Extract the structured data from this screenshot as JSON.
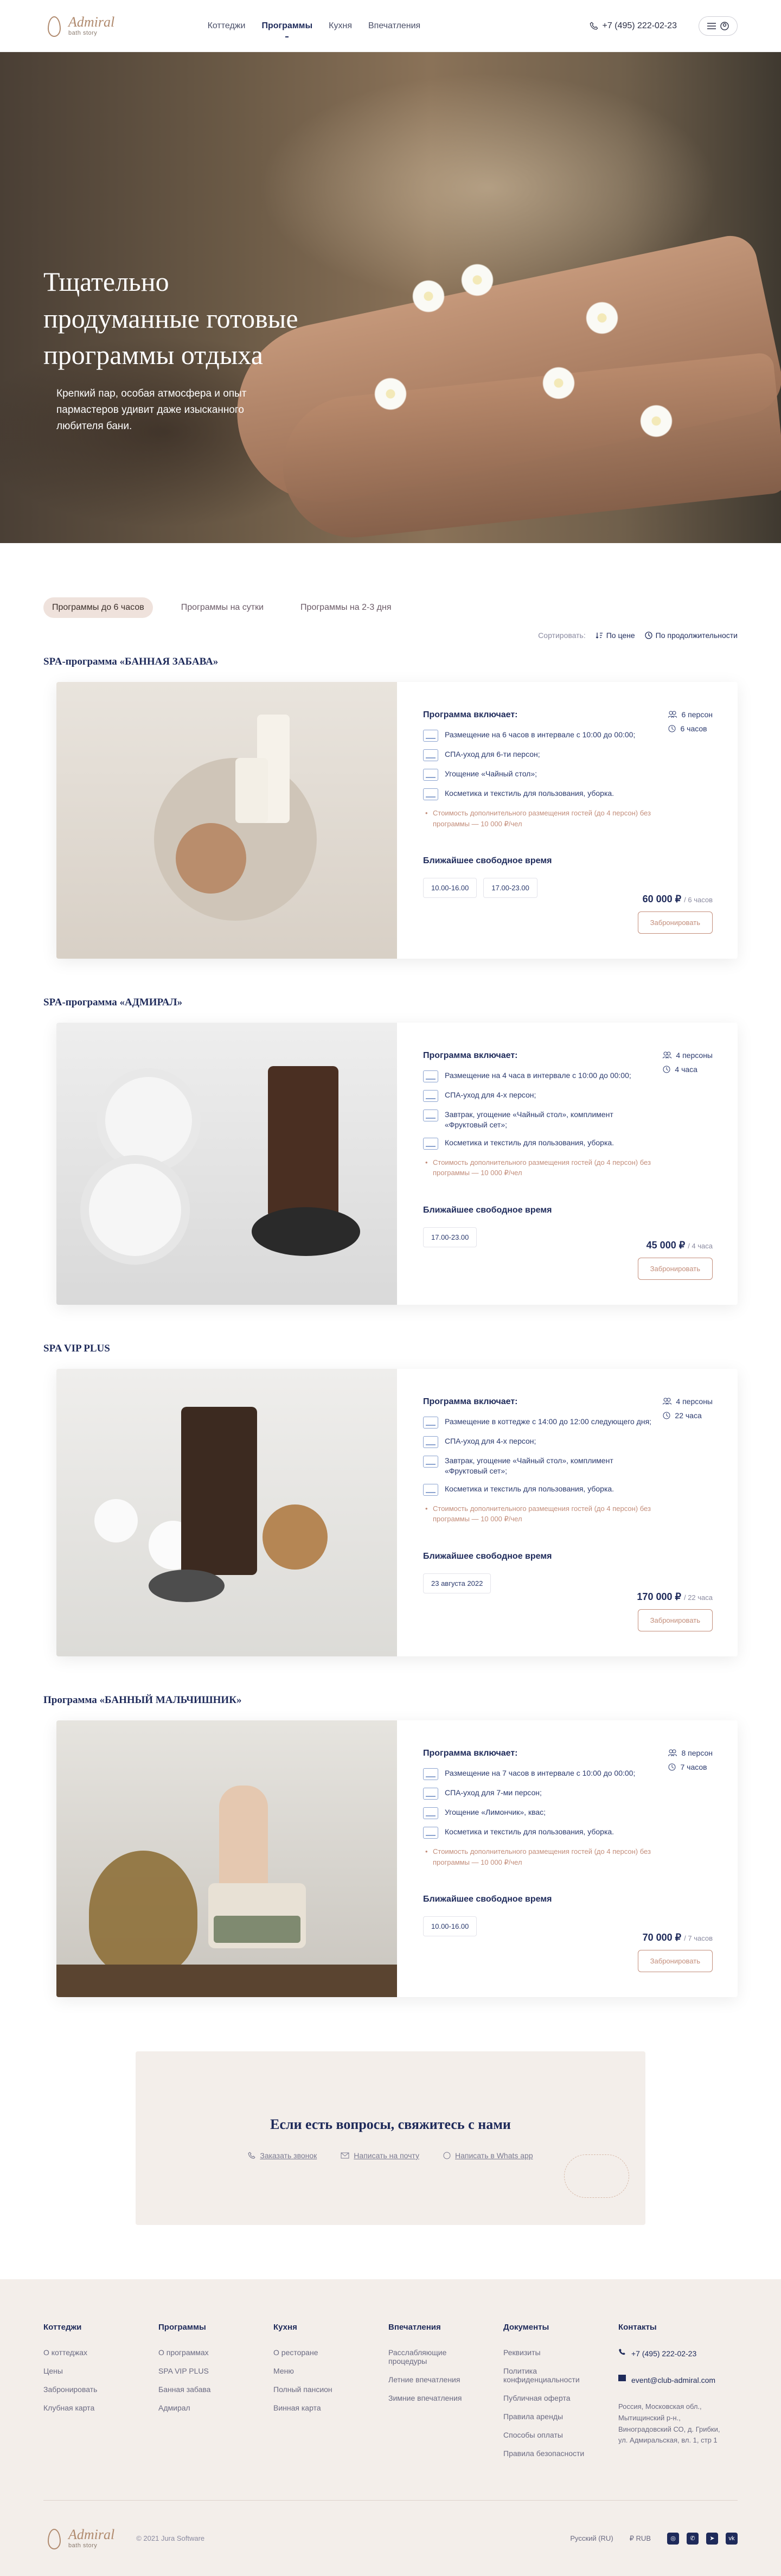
{
  "header": {
    "logo_title": "Admiral",
    "logo_sub": "bath story",
    "nav": [
      {
        "label": "Коттеджи"
      },
      {
        "label": "Программы"
      },
      {
        "label": "Кухня"
      },
      {
        "label": "Впечатления"
      }
    ],
    "phone": "+7 (495) 222-02-23"
  },
  "hero": {
    "title_line1": "Тщательно",
    "title_line2": "продуманные готовые",
    "title_line3": "программы отдыха",
    "desc": "Крепкий пар, особая атмосфера и опыт пармастеров удивит даже изысканного любителя бани."
  },
  "tabs": [
    {
      "label": "Программы до 6 часов"
    },
    {
      "label": "Программы на сутки"
    },
    {
      "label": "Программы на 2-3 дня"
    }
  ],
  "sort": {
    "label": "Сортировать:",
    "by_price": "По цене",
    "by_duration": "По продолжительности"
  },
  "programs": [
    {
      "title": "SPA-программа «БАННАЯ ЗАБАВА»",
      "includes_title": "Программа включает:",
      "items": [
        "Размещение на 6 часов в интервале с 10:00 до 00:00;",
        "СПА-уход для 6-ти персон;",
        "Угощение «Чайный стол»;",
        "Косметика и текстиль для пользования, уборка."
      ],
      "note": "Стоимость дополнительного размещения гостей (до 4 персон) без программы — 10 000 ₽/чел",
      "persons": "6 персон",
      "hours": "6 часов",
      "slots_title": "Ближайшее свободное время",
      "slots": [
        "10.00-16.00",
        "17.00-23.00"
      ],
      "price": "60 000 ₽",
      "price_unit": "/ 6 часов",
      "book": "Забронировать"
    },
    {
      "title": "SPA-программа «АДМИРАЛ»",
      "includes_title": "Программа включает:",
      "items": [
        "Размещение на 4 часа в интервале с 10:00 до 00:00;",
        "СПА-уход для 4-х персон;",
        "Завтрак, угощение «Чайный стол», комплимент «Фруктовый сет»;",
        "Косметика и текстиль для пользования, уборка."
      ],
      "note": "Стоимость дополнительного размещения гостей (до 4 персон) без программы — 10 000 ₽/чел",
      "persons": "4 персоны",
      "hours": "4 часа",
      "slots_title": "Ближайшее свободное время",
      "slots": [
        "17.00-23.00"
      ],
      "price": "45 000 ₽",
      "price_unit": "/ 4 часа",
      "book": "Забронировать"
    },
    {
      "title": "SPA VIP PLUS",
      "includes_title": "Программа включает:",
      "items": [
        "Размещение в коттедже с 14:00 до 12:00 следующего дня;",
        "СПА-уход для 4-х персон;",
        "Завтрак, угощение «Чайный стол», комплимент «Фруктовый сет»;",
        "Косметика и текстиль для пользования, уборка."
      ],
      "note": "Стоимость дополнительного размещения гостей (до 4 персон) без программы — 10 000 ₽/чел",
      "persons": "4 персоны",
      "hours": "22 часа",
      "slots_title": "Ближайшее свободное время",
      "slots": [
        "23 августа 2022"
      ],
      "price": "170 000 ₽",
      "price_unit": "/ 22 часа",
      "book": "Забронировать"
    },
    {
      "title": "Программа «БАННЫЙ МАЛЬЧИШНИК»",
      "includes_title": "Программа включает:",
      "items": [
        "Размещение на 7 часов в интервале с 10:00 до 00:00;",
        "СПА-уход для 7-ми персон;",
        "Угощение «Лимончик», квас;",
        "Косметика и текстиль для пользования, уборка."
      ],
      "note": "Стоимость дополнительного размещения гостей (до 4 персон) без программы — 10 000 ₽/чел",
      "persons": "8 персон",
      "hours": "7 часов",
      "slots_title": "Ближайшее свободное время",
      "slots": [
        "10.00-16.00"
      ],
      "price": "70 000 ₽",
      "price_unit": "/ 7 часов",
      "book": "Забронировать"
    }
  ],
  "contact": {
    "title": "Если есть вопросы, свяжитесь с нами",
    "call": "Заказать звонок",
    "mail": "Написать на почту",
    "whatsapp": "Написать в Whats app"
  },
  "footer": {
    "cols": [
      {
        "head": "Коттеджи",
        "links": [
          "О коттеджах",
          "Цены",
          "Забронировать",
          "Клубная карта"
        ]
      },
      {
        "head": "Программы",
        "links": [
          "О программах",
          "SPA VIP PLUS",
          "Банная забава",
          "Адмирал"
        ]
      },
      {
        "head": "Кухня",
        "links": [
          "О ресторане",
          "Меню",
          "Полный пансион",
          "Винная карта"
        ]
      },
      {
        "head": "Впечатления",
        "links": [
          "Расслабляющие процедуры",
          "Летние впечатления",
          "Зимние впечатления"
        ]
      },
      {
        "head": "Документы",
        "links": [
          "Реквизиты",
          "Политика конфиденциальности",
          "Публичная оферта",
          "Правила аренды",
          "Способы оплаты",
          "Правила безопасности"
        ]
      }
    ],
    "contacts_head": "Контакты",
    "phone": "+7 (495) 222-02-23",
    "email": "event@club-admiral.com",
    "address": "Россия, Московская обл., Мытищинский р-н., Виноградовский СО, д. Грибки, ул. Адмиральская, вл. 1, стр 1",
    "copyright": "© 2021 Jura Software",
    "lang": "Русский (RU)",
    "currency": "₽  RUB",
    "social": [
      "ig",
      "wa",
      "tg",
      "vk"
    ]
  }
}
